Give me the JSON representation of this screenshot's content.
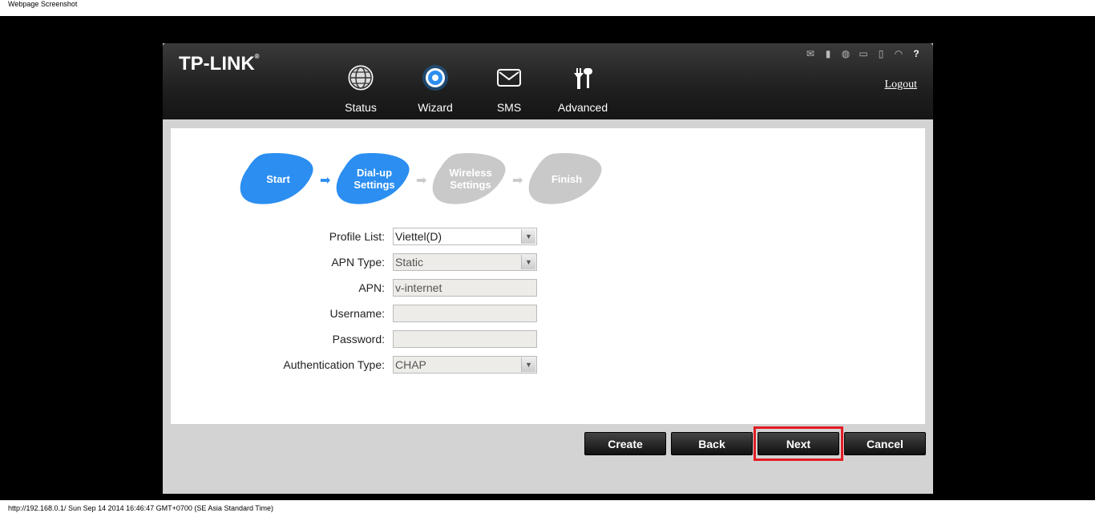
{
  "window": {
    "title": "Webpage Screenshot"
  },
  "footer": {
    "text": "http://192.168.0.1/ Sun Sep 14 2014 16:46:47 GMT+0700 (SE Asia Standard Time)"
  },
  "brand": {
    "logo": "TP-LINK",
    "mark": "®"
  },
  "nav": [
    {
      "label": "Status",
      "icon": "globe-icon"
    },
    {
      "label": "Wizard",
      "icon": "gear-icon",
      "active": true
    },
    {
      "label": "SMS",
      "icon": "envelope-icon"
    },
    {
      "label": "Advanced",
      "icon": "tools-icon"
    }
  ],
  "header": {
    "logout": "Logout"
  },
  "status_icons": [
    "mail-icon",
    "signal-icon",
    "globe-icon",
    "battery-icon",
    "sd-card-icon",
    "wifi-icon",
    "help-icon"
  ],
  "wizard": {
    "steps": [
      {
        "label": "Start",
        "state": "done"
      },
      {
        "label": "Dial-up Settings",
        "state": "active"
      },
      {
        "label": "Wireless Settings",
        "state": "pending"
      },
      {
        "label": "Finish",
        "state": "pending"
      }
    ],
    "colors": {
      "active": "#2b8ef0",
      "pending": "#c9c9c9"
    }
  },
  "form": {
    "profile_list": {
      "label": "Profile List:",
      "value": "Viettel(D)"
    },
    "apn_type": {
      "label": "APN Type:",
      "value": "Static"
    },
    "apn": {
      "label": "APN:",
      "value": "v-internet"
    },
    "username": {
      "label": "Username:",
      "value": ""
    },
    "password": {
      "label": "Password:",
      "value": ""
    },
    "auth_type": {
      "label": "Authentication Type:",
      "value": "CHAP"
    }
  },
  "buttons": {
    "create": "Create",
    "back": "Back",
    "next": "Next",
    "cancel": "Cancel"
  }
}
